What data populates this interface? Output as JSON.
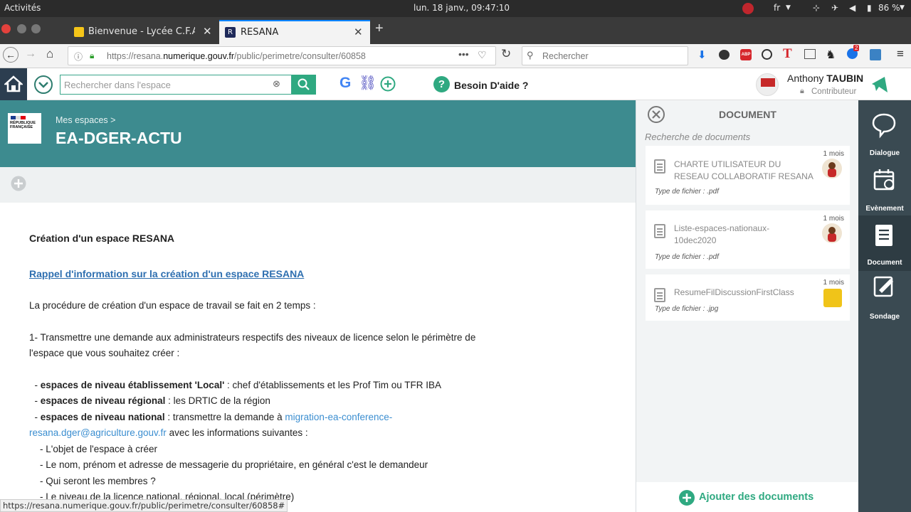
{
  "os": {
    "activities": "Activités",
    "clock": "lun. 18 janv., 09:47:10",
    "lang": "fr",
    "battery": "86 %"
  },
  "tabs": [
    {
      "label": "Bienvenue - Lycée C.F.A. du"
    },
    {
      "label": "RESANA"
    }
  ],
  "url": {
    "prefix": "https://resana.",
    "domain": "numerique.gouv.fr",
    "path": "/public/perimetre/consulter/60858"
  },
  "browser_search": {
    "placeholder": "Rechercher"
  },
  "app": {
    "search_placeholder": "Rechercher dans  l'espace",
    "help_label": "Besoin D'aide ?",
    "user_first": "Anthony",
    "user_last": "TAUBIN",
    "user_role": "Contributeur"
  },
  "banner": {
    "breadcrumb": "Mes espaces >",
    "title": "EA-DGER-ACTU",
    "logo_text": "RÉPUBLIQUE FRANÇAISE"
  },
  "content": {
    "heading": "Création d'un espace RESANA",
    "link": "Rappel d'information sur la création d'un espace RESANA",
    "p1": "La procédure de création d'un espace de travail se fait en 2 temps :",
    "p2a": "1- Transmettre une demande aux administrateurs respectifs des niveaux de licence selon le périmètre de",
    "p2b": "l'espace que vous souhaitez créer :",
    "l1_dash": "  - ",
    "l1_bold": "espaces de niveau établissement 'Local'",
    "l1_rest": " : chef d'établissements et les Prof Tim ou TFR IBA",
    "l2_bold": "espaces de niveau régional",
    "l2_rest": " : les DRTIC de la région",
    "l3_bold": "espaces de niveau national",
    "l3_rest": " : transmettre la demande à ",
    "l3_mail1": "migration-ea-conference-",
    "l3_mail2": "resana.dger@agriculture.gouv.fr",
    "l3_after": " avec les informations suivantes :",
    "s1": "- L'objet de l'espace à créer",
    "s2": "- Le nom, prénom et adresse de messagerie du propriétaire, en général c'est le demandeur",
    "s3": "- Qui seront les membres ?",
    "s4": "- Le niveau de la licence national, régional, local (périmètre)"
  },
  "panel": {
    "title": "DOCUMENT",
    "search_label": "Recherche de documents",
    "docs": [
      {
        "name": "CHARTE UTILISATEUR DU RESEAU COLLABORATIF RESANA",
        "age": "1 mois",
        "type": "Type de fichier : .pdf"
      },
      {
        "name": "Liste-espaces-nationaux-10dec2020",
        "age": "1 mois",
        "type": "Type de fichier : .pdf"
      },
      {
        "name": "ResumeFilDiscussionFirstClass",
        "age": "1 mois",
        "type": "Type de fichier : .jpg"
      }
    ],
    "add_label": "Ajouter des documents"
  },
  "rail": [
    {
      "label": "Dialogue",
      "icon": "chat-icon"
    },
    {
      "label": "Evènement",
      "icon": "calendar-icon"
    },
    {
      "label": "Document",
      "icon": "document-icon"
    },
    {
      "label": "Sondage",
      "icon": "poll-icon"
    }
  ],
  "status": "https://resana.numerique.gouv.fr/public/perimetre/consulter/60858#"
}
